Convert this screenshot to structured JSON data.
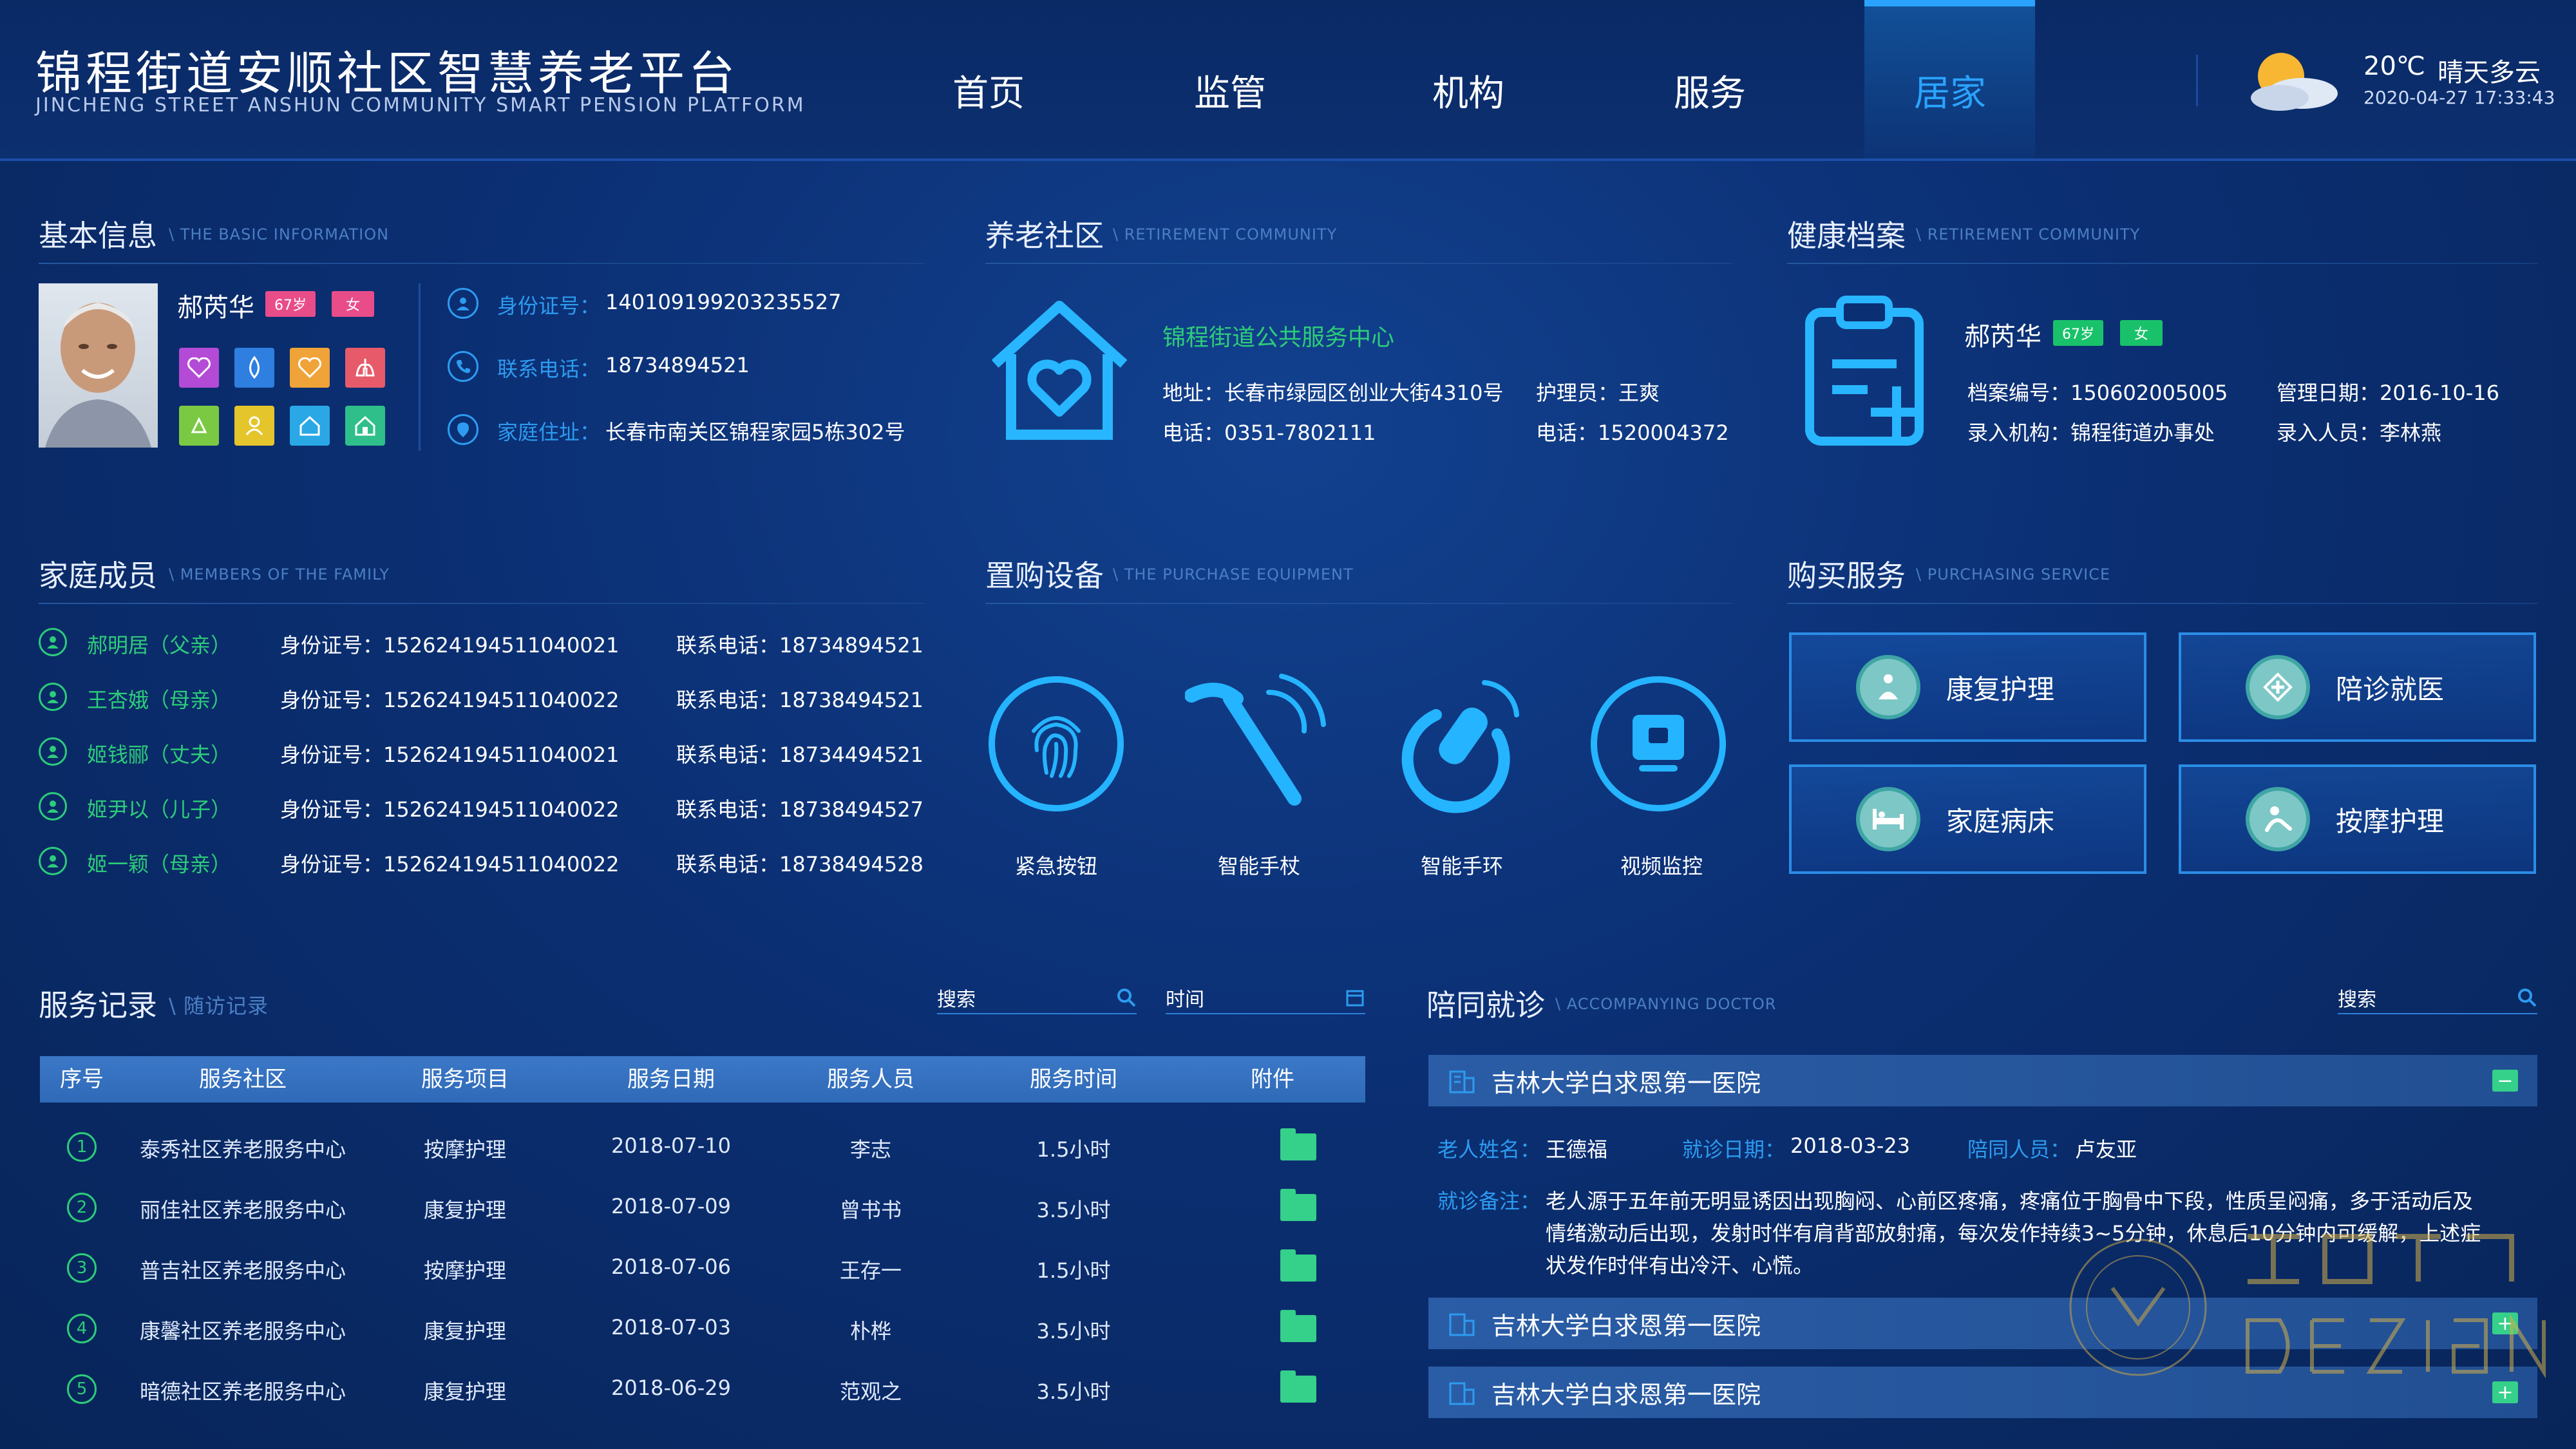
{
  "header": {
    "title": "锦程街道安顺社区智慧养老平台",
    "subtitle": "JINCHENG STREET ANSHUN COMMUNITY SMART PENSION PLATFORM",
    "nav": [
      "首页",
      "监管",
      "机构",
      "服务",
      "居家"
    ],
    "active_nav": "居家",
    "weather": {
      "temp": "20℃",
      "desc": "晴天多云",
      "time": "2020-04-27 17:33:43",
      "icon": "sun-cloud-icon"
    }
  },
  "basic": {
    "title": "基本信息",
    "sub": "THE BASIC INFORMATION",
    "name": "郝芮华",
    "age": "67岁",
    "gender": "女",
    "id_label": "身份证号：",
    "id": "140109199203235527",
    "phone_label": "联系电话：",
    "phone": "18734894521",
    "addr_label": "家庭住址：",
    "addr": "长春市南关区锦程家园5栋302号"
  },
  "community": {
    "title": "养老社区",
    "sub": "RETIREMENT COMMUNITY",
    "center": "锦程街道公共服务中心",
    "address": "地址：长春市绿园区创业大街4310号",
    "nurse": "护理员：王爽",
    "tel": "电话：0351-7802111",
    "tel2": "电话：1520004372"
  },
  "health": {
    "title": "健康档案",
    "sub": "RETIREMENT COMMUNITY",
    "name": "郝芮华",
    "age": "67岁",
    "gender": "女",
    "record_no": "档案编号：150602005005",
    "manage_date": "管理日期：2016-10-16",
    "org": "录入机构：锦程街道办事处",
    "person": "录入人员：李林燕"
  },
  "family": {
    "title": "家庭成员",
    "sub": "MEMBERS OF THE FAMILY",
    "members": [
      {
        "name": "郝明居（父亲）",
        "id": "身份证号：152624194511040021",
        "phone": "联系电话：18734894521"
      },
      {
        "name": "王杏娥（母亲）",
        "id": "身份证号：152624194511040022",
        "phone": "联系电话：18738494521"
      },
      {
        "name": "姬钱郦（丈夫）",
        "id": "身份证号：152624194511040021",
        "phone": "联系电话：18734494521"
      },
      {
        "name": "姬尹以（儿子）",
        "id": "身份证号：152624194511040022",
        "phone": "联系电话：18738494527"
      },
      {
        "name": "姬一颖（母亲）",
        "id": "身份证号：152624194511040022",
        "phone": "联系电话：18738494528"
      }
    ]
  },
  "equipment": {
    "title": "置购设备",
    "sub": "THE PURCHASE EQUIPMENT",
    "items": [
      {
        "label": "紧急按钮",
        "icon": "fingerprint-icon"
      },
      {
        "label": "智能手杖",
        "icon": "cane-icon"
      },
      {
        "label": "智能手环",
        "icon": "bracelet-icon"
      },
      {
        "label": "视频监控",
        "icon": "monitor-icon"
      }
    ]
  },
  "purchase": {
    "title": "购买服务",
    "sub": "PURCHASING SERVICE",
    "items": [
      {
        "label": "康复护理",
        "icon": "rehab-icon"
      },
      {
        "label": "陪诊就医",
        "icon": "medical-icon"
      },
      {
        "label": "家庭病床",
        "icon": "bed-icon"
      },
      {
        "label": "按摩护理",
        "icon": "massage-icon"
      }
    ]
  },
  "records": {
    "title": "服务记录",
    "sub": "随访记录",
    "search_placeholder": "搜索",
    "time_placeholder": "时间",
    "columns": [
      "序号",
      "服务社区",
      "服务项目",
      "服务日期",
      "服务人员",
      "服务时间",
      "附件"
    ],
    "rows": [
      [
        "1",
        "泰秀社区养老服务中心",
        "按摩护理",
        "2018-07-10",
        "李志",
        "1.5小时"
      ],
      [
        "2",
        "丽佳社区养老服务中心",
        "康复护理",
        "2018-07-09",
        "曾书书",
        "3.5小时"
      ],
      [
        "3",
        "普吉社区养老服务中心",
        "按摩护理",
        "2018-07-06",
        "王存一",
        "1.5小时"
      ],
      [
        "4",
        "康馨社区养老服务中心",
        "康复护理",
        "2018-07-03",
        "朴桦",
        "3.5小时"
      ],
      [
        "5",
        "暗德社区养老服务中心",
        "康复护理",
        "2018-06-29",
        "范观之",
        "3.5小时"
      ]
    ]
  },
  "escort": {
    "title": "陪同就诊",
    "sub": "ACCOMPANYING DOCTOR",
    "search_placeholder": "搜索",
    "hospital1": "吉林大学白求恩第一医院",
    "elder_label": "老人姓名：",
    "elder": "王德福",
    "date_label": "就诊日期：",
    "date": "2018-03-23",
    "companion_label": "陪同人员：",
    "companion": "卢友亚",
    "note_label": "就诊备注：",
    "note_lines": [
      "老人源于五年前无明显诱因出现胸闷、心前区疼痛，疼痛位于胸骨中下段，性质呈闷痛，多于活动后及",
      "情绪激动后出现，发射时伴有肩背部放射痛，每次发作持续3~5分钟，休息后10分钟内可缓解，上述症",
      "状发作时伴有出冷汗、心慌。"
    ],
    "hospital2": "吉林大学白求恩第一医院",
    "hospital3": "吉林大学白求恩第一医院"
  },
  "watermark": "尚奕設計 DESIGN"
}
